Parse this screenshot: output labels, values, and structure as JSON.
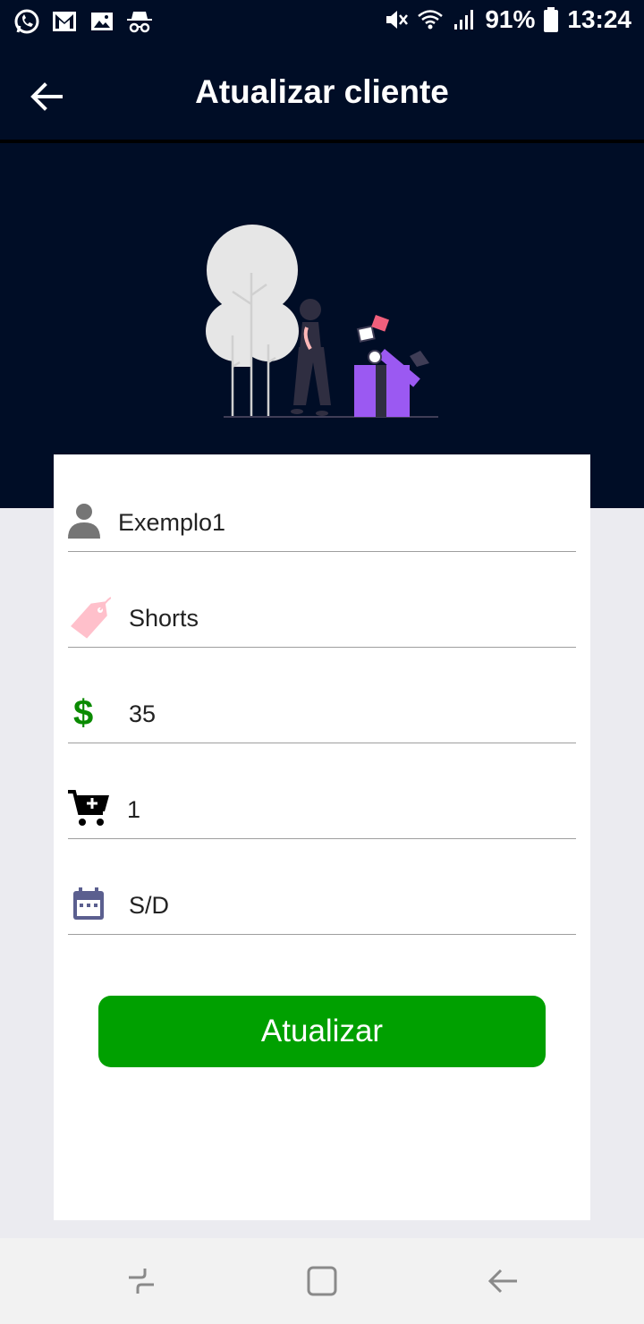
{
  "status_bar": {
    "left_icons": [
      "whatsapp-icon",
      "gmail-icon",
      "gallery-icon",
      "incognito-icon"
    ],
    "right_icons": [
      "mute-icon",
      "wifi-icon",
      "signal-icon",
      "battery-icon"
    ],
    "battery": "91%",
    "time": "13:24"
  },
  "app_bar": {
    "title": "Atualizar cliente",
    "back_icon": "arrow-back-icon",
    "background": "#000d26"
  },
  "form": {
    "name": {
      "value": "Exemplo1",
      "icon": "person-icon"
    },
    "product": {
      "value": "Shorts",
      "icon": "price-tag-icon"
    },
    "price": {
      "value": "35",
      "icon": "dollar-icon"
    },
    "quantity": {
      "value": "1",
      "icon": "add-cart-icon"
    },
    "date": {
      "value": "S/D",
      "icon": "calendar-icon"
    }
  },
  "update_button": {
    "label": "Atualizar",
    "color": "#00a000"
  },
  "nav_bar": {
    "icons": [
      "recent-apps-icon",
      "home-icon",
      "back-icon"
    ]
  }
}
